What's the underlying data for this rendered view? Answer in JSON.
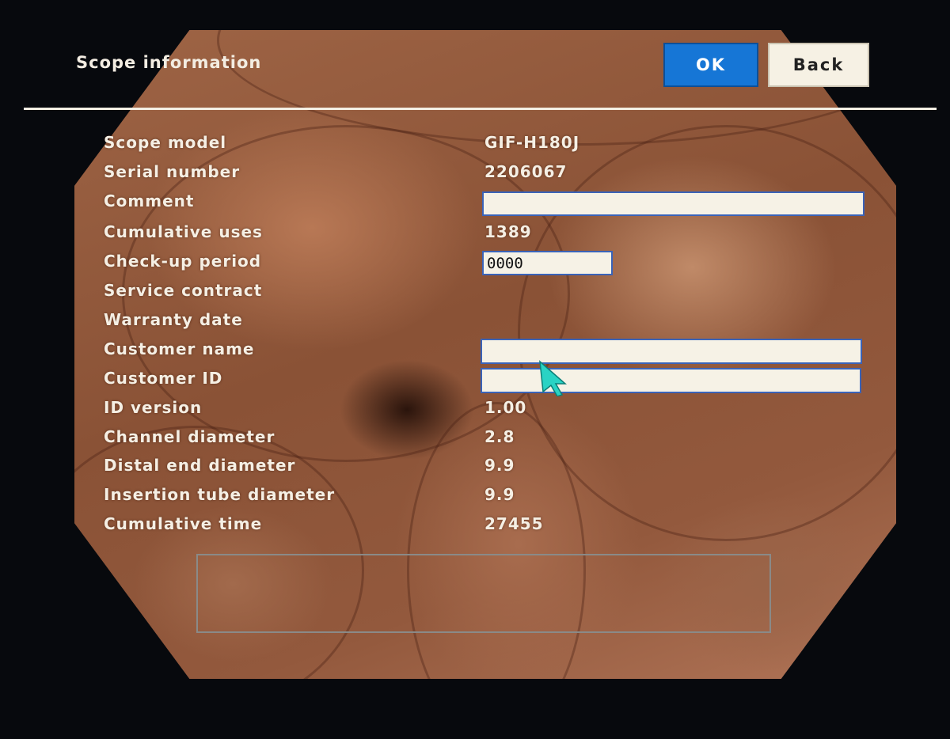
{
  "header": {
    "title": "Scope information",
    "ok_label": "OK",
    "back_label": "Back"
  },
  "fields": {
    "scope_model": {
      "label": "Scope model",
      "value": "GIF-H180J"
    },
    "serial_number": {
      "label": "Serial number",
      "value": "2206067"
    },
    "comment": {
      "label": "Comment",
      "value": ""
    },
    "cumulative_uses": {
      "label": "Cumulative uses",
      "value": "1389"
    },
    "checkup_period": {
      "label": "Check-up period",
      "value": "0000"
    },
    "service_contract": {
      "label": "Service contract"
    },
    "warranty_date": {
      "label": "Warranty date"
    },
    "customer_name": {
      "label": "Customer name",
      "value": ""
    },
    "customer_id": {
      "label": "Customer ID",
      "value": ""
    },
    "id_version": {
      "label": "ID version",
      "value": "1.00"
    },
    "channel_diameter": {
      "label": "Channel diameter",
      "value": "2.8"
    },
    "distal_end_diameter": {
      "label": "Distal end diameter",
      "value": "9.9"
    },
    "insertion_tube_diameter": {
      "label": "Insertion tube diameter",
      "value": "9.9"
    },
    "cumulative_time": {
      "label": "Cumulative time",
      "value": "27455"
    }
  },
  "colors": {
    "ok_button": "#1676d6",
    "back_button": "#f6f1e4",
    "field_border": "#3a63b8",
    "cursor": "#2ad3c4"
  },
  "icons": {
    "pointer": "mouse-pointer-icon"
  }
}
